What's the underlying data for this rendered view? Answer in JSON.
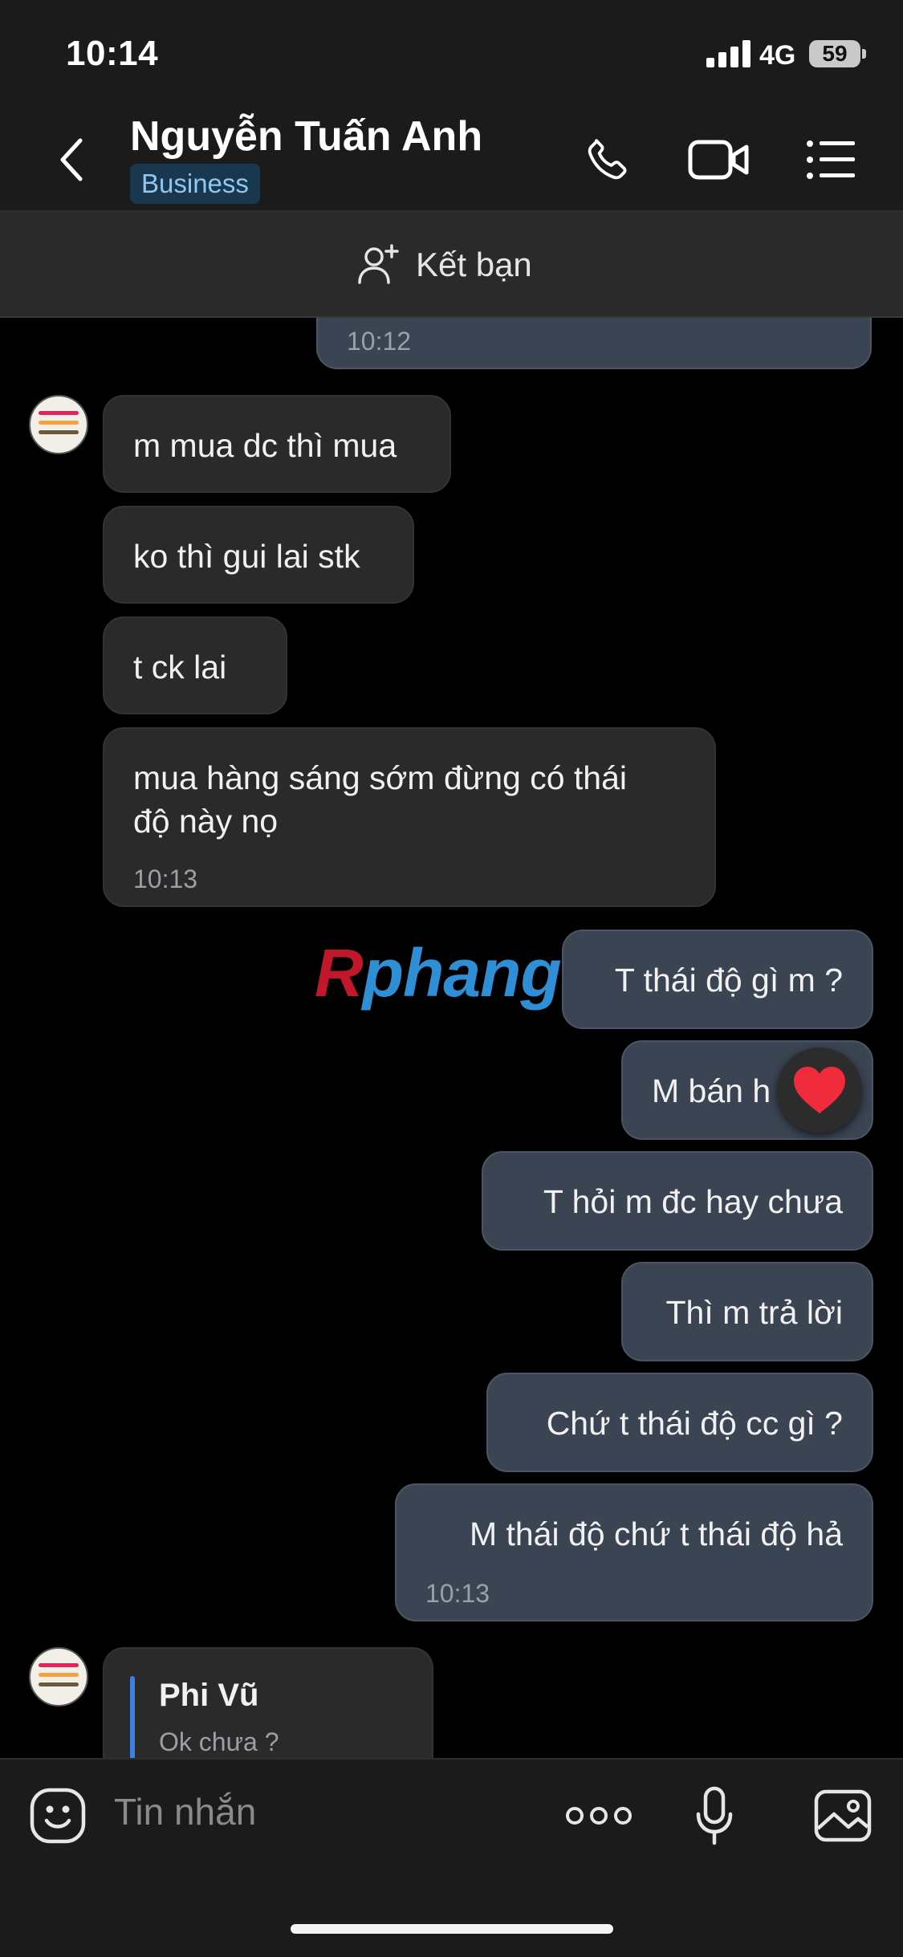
{
  "status_bar": {
    "time": "10:14",
    "network": "4G",
    "battery": "59"
  },
  "header": {
    "contact_name": "Nguyễn Tuấn Anh",
    "badge": "Business",
    "icons": [
      "back-icon",
      "phone-icon",
      "video-call-icon",
      "menu-list-icon"
    ]
  },
  "add_friend": {
    "label": "Kết bạn",
    "icon": "add-friend-icon"
  },
  "messages": [
    {
      "side": "out",
      "text": "",
      "time": "10:12"
    },
    {
      "side": "in",
      "text": "m mua dc thì mua"
    },
    {
      "side": "in",
      "text": "ko thì gui lai stk"
    },
    {
      "side": "in",
      "text": "t ck lai"
    },
    {
      "side": "in",
      "text_line1": "mua hàng sáng sớm đừng có thái",
      "text_line2": "độ này nọ",
      "time": "10:13"
    },
    {
      "side": "out",
      "text": "T thái độ gì m ?"
    },
    {
      "side": "out",
      "text": "M bán h",
      "reaction": "heart"
    },
    {
      "side": "out",
      "text": "T hỏi m đc hay chưa"
    },
    {
      "side": "out",
      "text": "Thì m trả lời"
    },
    {
      "side": "out",
      "text": "Chứ t thái độ cc gì ?"
    },
    {
      "side": "out",
      "text": "M thái độ chứ t thái độ hả",
      "time": "10:13"
    }
  ],
  "reply_preview": {
    "name": "Phi Vũ",
    "text": "Ok chưa ?"
  },
  "watermark": {
    "first": "R",
    "rest": "phang"
  },
  "input": {
    "placeholder": "Tin nhắn",
    "icons": [
      "emoji-icon",
      "more-icon",
      "microphone-icon",
      "image-icon"
    ]
  },
  "colors": {
    "incoming_bubble": "#2a2a2a",
    "outgoing_bubble": "#3a4452",
    "badge_bg": "#19384f",
    "badge_text": "#8ec7ef"
  }
}
